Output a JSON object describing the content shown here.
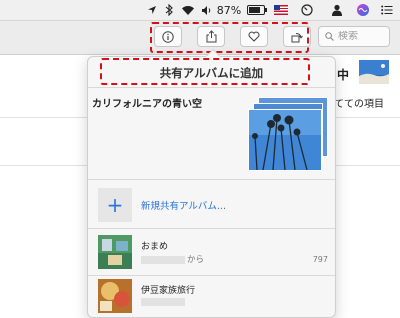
{
  "menubar": {
    "battery_percent": "87%",
    "battery_level": 0.87
  },
  "toolbar": {
    "search_placeholder": "検索"
  },
  "popover": {
    "title": "共有アルバムに追加",
    "album_title": "カリフォルニアの青い空",
    "new_album_label": "新規共有アルバム...",
    "albums": [
      {
        "name": "おまめ",
        "sub": "から",
        "count": "797"
      },
      {
        "name": "伊豆家族旅行",
        "sub": "",
        "count": ""
      }
    ]
  },
  "background": {
    "partial_char": "中",
    "partial_items": "てての項目"
  },
  "colors": {
    "highlight": "#d4101a",
    "accent": "#2d74d8"
  }
}
